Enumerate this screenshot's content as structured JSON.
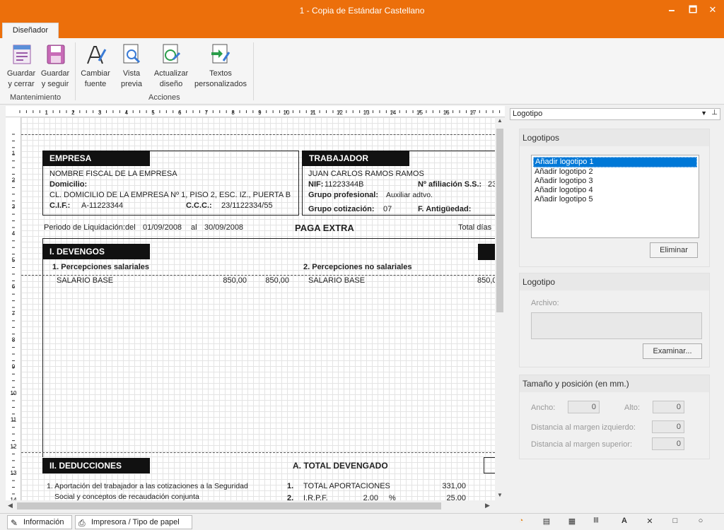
{
  "window": {
    "title": "1 - Copia de Estándar Castellano",
    "minimize": "🗕",
    "maximize": "🗖",
    "close": "✕"
  },
  "tabs": {
    "active": "Diseñador"
  },
  "ribbon": {
    "buttons": {
      "guardar_cerrar": "Guardar\ny cerrar",
      "guardar_seguir": "Guardar\ny seguir",
      "cambiar_fuente": "Cambiar\nfuente",
      "vista_previa": "Vista\nprevia",
      "actualizar_diseno": "Actualizar\ndiseño",
      "textos_personalizados": "Textos\npersonalizados"
    },
    "groups": {
      "mantenimiento": "Mantenimiento",
      "acciones": "Acciones"
    }
  },
  "ruler": {
    "h_numbers": [
      "1",
      "2",
      "3",
      "4",
      "5",
      "6",
      "7",
      "8",
      "9",
      "10",
      "11",
      "12",
      "13",
      "14",
      "15",
      "16",
      "17"
    ],
    "v_numbers": [
      "1",
      "2",
      "3",
      "4",
      "5",
      "6",
      "7",
      "8",
      "9",
      "10",
      "11",
      "12",
      "13",
      "14"
    ]
  },
  "doc": {
    "empresa": {
      "header": "EMPRESA",
      "nombre": "NOMBRE FISCAL DE LA EMPRESA",
      "domicilio_label": "Domicilio:",
      "domicilio": "CL. DOMICILIO DE LA EMPRESA Nº 1, PISO 2, ESC. IZ., PUERTA B",
      "cif_label": "C.I.F.:",
      "cif": "A-11223344",
      "ccc_label": "C.C.C.:",
      "ccc": "23/1122334/55"
    },
    "trabajador": {
      "header": "TRABAJADOR",
      "nombre": "JUAN CARLOS RAMOS RAMOS",
      "nif_label": "NIF:",
      "nif": "11223344B",
      "afiliacion_label": "Nº afiliación S.S.:",
      "afiliacion": "23",
      "grupo_prof_label": "Grupo profesional:",
      "grupo_prof": "Auxiliar adtvo.",
      "grupo_cot_label": "Grupo cotización:",
      "grupo_cot": "07",
      "antiguedad_label": "F. Antigüedad:"
    },
    "periodo": {
      "label": "Periodo de Liquidación:del",
      "desde": "01/09/2008",
      "al": "al",
      "hasta": "30/09/2008",
      "titulo": "PAGA EXTRA",
      "total_dias": "Total días"
    },
    "devengos": {
      "header": "I. DEVENGOS",
      "col1": "1. Percepciones salariales",
      "col2": "2. Percepciones no salariales",
      "row1_concepto": "SALARIO BASE",
      "row1_v1": "850,00",
      "row1_v2": "850,00",
      "row1_concepto2": "SALARIO BASE",
      "row1_v3": "850,0"
    },
    "deducciones": {
      "header": "II. DEDUCCIONES",
      "total_devengado": "A. TOTAL DEVENGADO",
      "line1a": "1. Aportación del trabajador a las cotizaciones a la Seguridad",
      "line1b": "Social y conceptos de recaudación conjunta",
      "num1": "1.",
      "total_aport": "TOTAL APORTACIONES",
      "total_aport_val": "331,00",
      "num2": "2.",
      "irpf": "I.R.P.F.",
      "irpf_pct": "2,00",
      "pct": "%",
      "irpf_val": "25,00"
    }
  },
  "panel": {
    "combo": "Logotipo",
    "logotipos": {
      "title": "Logotipos",
      "items": [
        "Añadir logotipo 1",
        "Añadir logotipo 2",
        "Añadir logotipo 3",
        "Añadir logotipo 4",
        "Añadir logotipo 5"
      ],
      "eliminar": "Eliminar"
    },
    "logotipo": {
      "title": "Logotipo",
      "archivo_label": "Archivo:",
      "examinar": "Examinar..."
    },
    "tamano": {
      "title": "Tamaño y posición (en mm.)",
      "ancho_label": "Ancho:",
      "ancho": "0",
      "alto_label": "Alto:",
      "alto": "0",
      "izq_label": "Distancia al margen izquierdo:",
      "izq": "0",
      "sup_label": "Distancia al margen superior:",
      "sup": "0"
    }
  },
  "bottom": {
    "tab1": "Información",
    "tab2": "Impresora / Tipo de papel"
  }
}
